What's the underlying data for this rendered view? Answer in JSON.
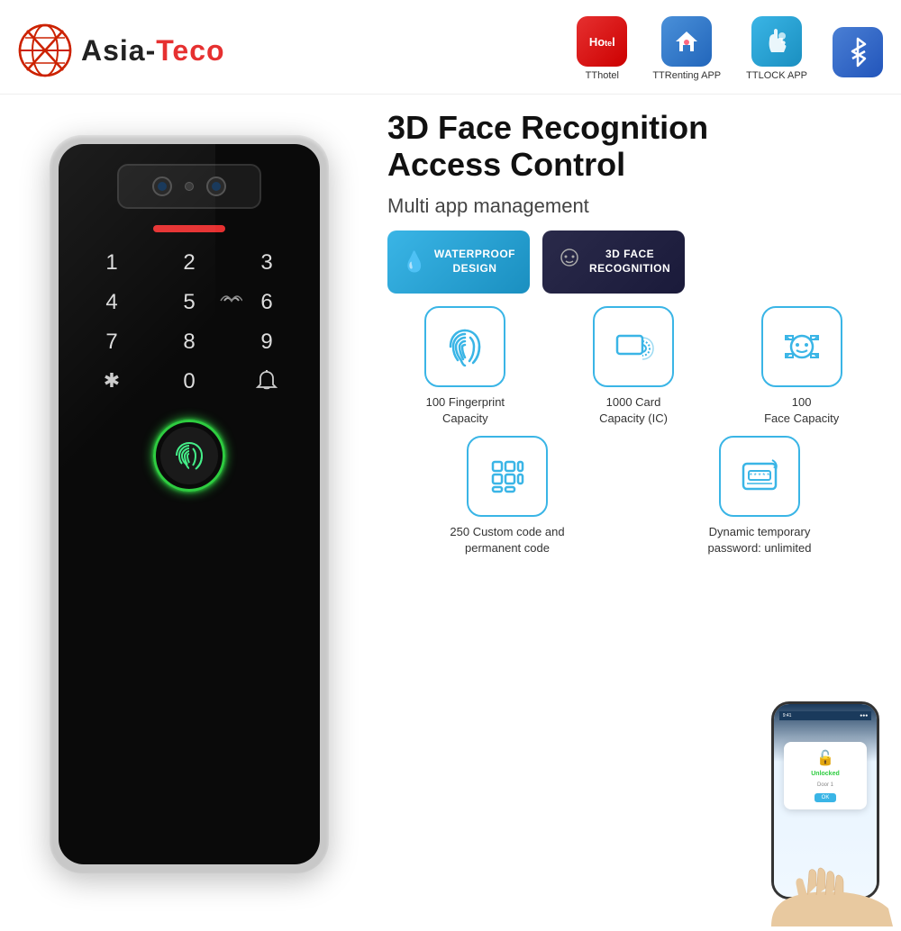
{
  "brand": {
    "name": "Asia-Teco",
    "name_part1": "Asia-",
    "name_part2": "Teco"
  },
  "header": {
    "apps": [
      {
        "id": "tthotel",
        "label": "TThotel",
        "icon": "🏨",
        "bg": "hotel"
      },
      {
        "id": "ttrenting",
        "label": "TTRenting APP",
        "icon": "🏠",
        "bg": "home"
      },
      {
        "id": "ttlock",
        "label": "TTLOCK APP",
        "icon": "✋",
        "bg": "hand"
      },
      {
        "id": "bluetooth",
        "label": "",
        "icon": "⚡",
        "bg": "bt"
      }
    ]
  },
  "product": {
    "title_line1": "3D Face Recognition",
    "title_line2": "Access Control",
    "subtitle": "Multi app management",
    "badge_waterproof": "WATERPROOF\nDESIGN",
    "badge_face": "3D FACE\nRECOGNITION"
  },
  "features": [
    {
      "icon": "fingerprint",
      "label": "100 Fingerprint\nCapacity"
    },
    {
      "icon": "card",
      "label": "1000 Card\nCapacity (IC)"
    },
    {
      "icon": "face",
      "label": "100\nFace Capacity"
    }
  ],
  "features_bottom": [
    {
      "icon": "keypad",
      "label": "250 Custom code and\npermanent code"
    },
    {
      "icon": "password",
      "label": "Dynamic temporary\npassword: unlimited"
    }
  ],
  "device": {
    "keys": [
      "1",
      "2",
      "3",
      "4",
      "5",
      "6",
      "7",
      "8",
      "9",
      "*",
      "0",
      "🔔"
    ]
  }
}
